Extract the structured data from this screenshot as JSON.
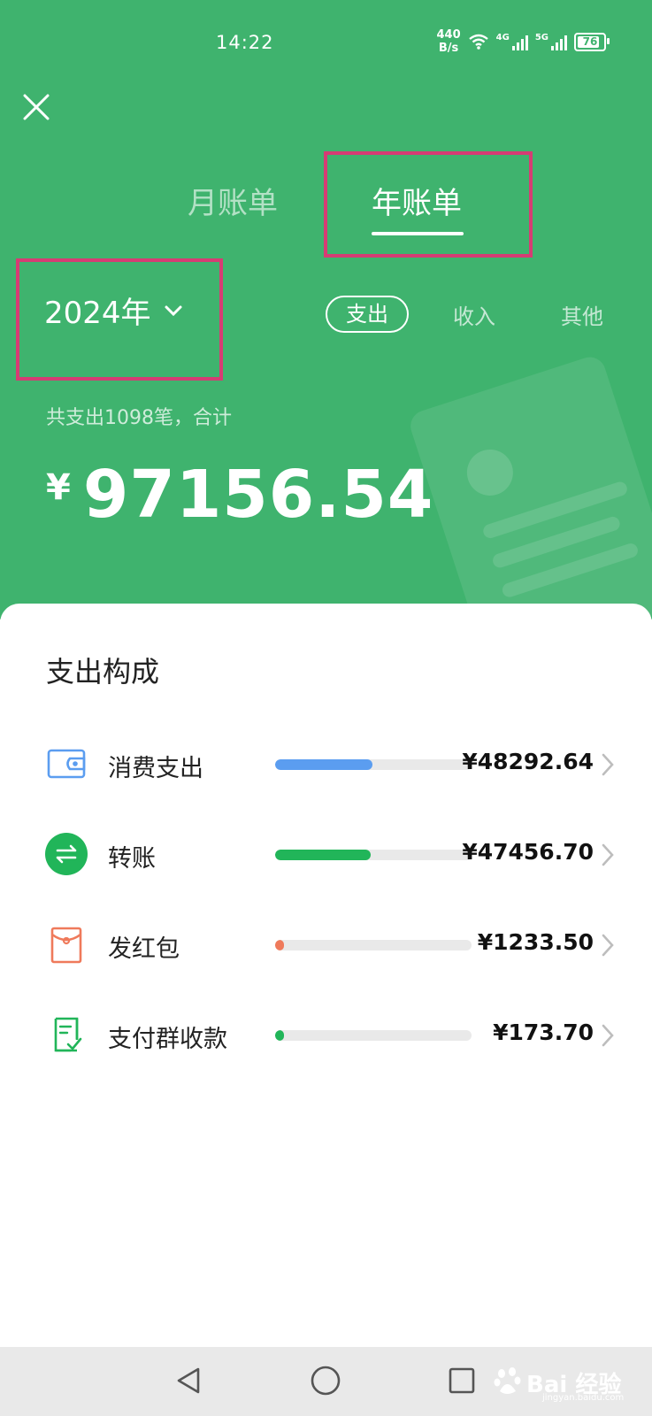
{
  "status_bar": {
    "time": "14:22",
    "speed_value": "440",
    "speed_unit": "B/s",
    "signal_1": "4G",
    "signal_2": "5G",
    "battery": "76"
  },
  "header": {
    "tabs": [
      {
        "label": "月账单"
      },
      {
        "label": "年账单"
      }
    ],
    "year": "2024年",
    "filters": [
      {
        "label": "支出"
      },
      {
        "label": "收入"
      },
      {
        "label": "其他"
      }
    ],
    "summary": "共支出1098笔，合计",
    "currency": "¥",
    "total": "97156.54"
  },
  "panel": {
    "title": "支出构成",
    "items": [
      {
        "label": "消费支出",
        "value": "¥48292.64",
        "share": 0.497,
        "color": "#5b9df0",
        "icon": "wallet-icon"
      },
      {
        "label": "转账",
        "value": "¥47456.70",
        "share": 0.488,
        "color": "#21b559",
        "icon": "transfer-icon"
      },
      {
        "label": "发红包",
        "value": "¥1233.50",
        "share": 0.013,
        "color": "#ef7a5b",
        "icon": "red-packet-icon"
      },
      {
        "label": "支付群收款",
        "value": "¥173.70",
        "share": 0.002,
        "color": "#21b559",
        "icon": "group-payment-icon"
      }
    ]
  },
  "watermark": {
    "text": "Bai 经验",
    "url": "jingyan.baidu.com"
  },
  "colors": {
    "header_green": "#3fb36e",
    "highlight": "#d63c74"
  }
}
